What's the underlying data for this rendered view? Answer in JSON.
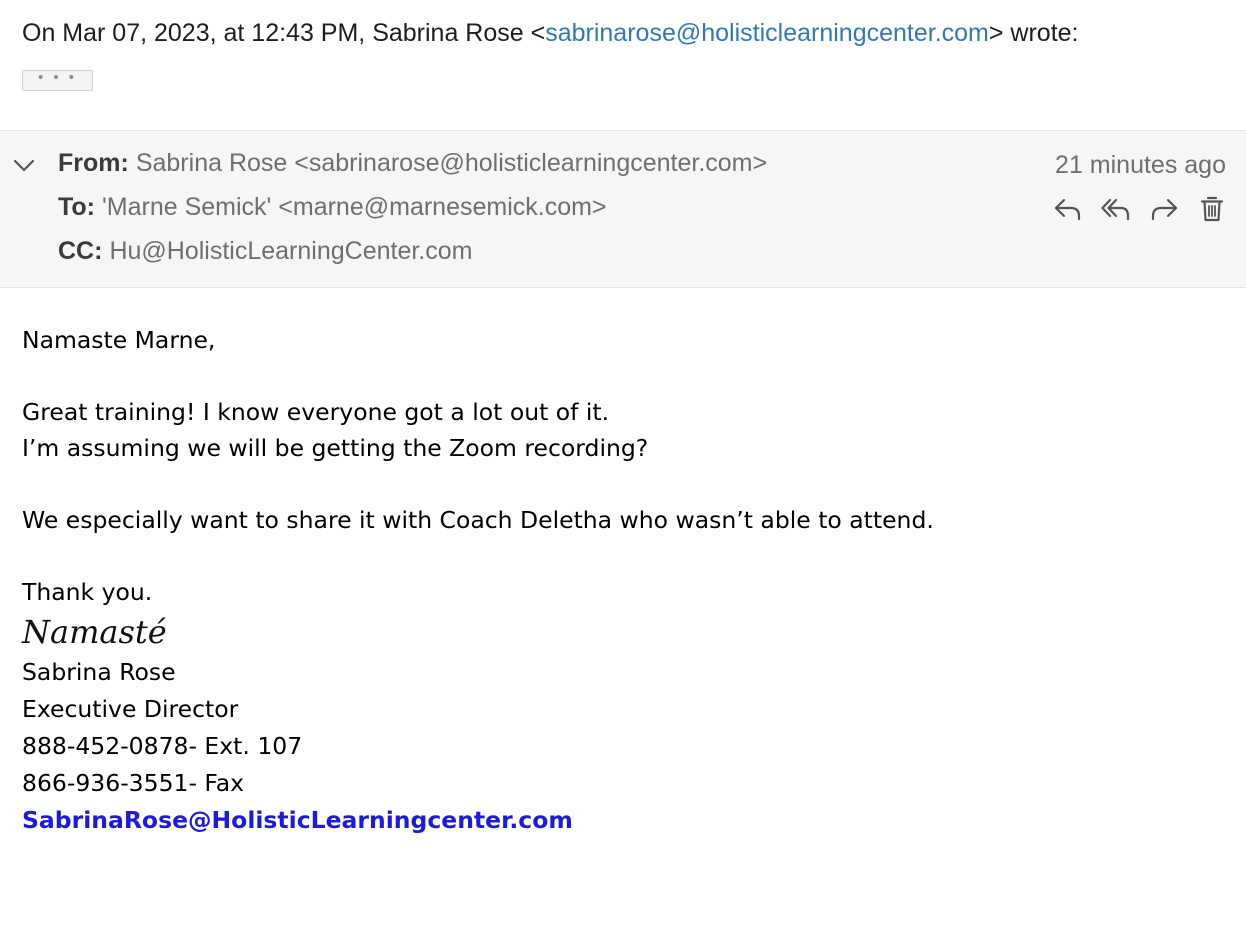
{
  "quoted": {
    "prefix": "On Mar 07, 2023, at 12:43 PM, Sabrina Rose <",
    "email": "sabrinarose@holisticlearningcenter.com",
    "suffix": "> wrote:",
    "ellipsis": "• • •"
  },
  "header": {
    "from_label": "From:",
    "from_value": "Sabrina Rose <sabrinarose@holisticlearningcenter.com>",
    "to_label": "To:",
    "to_value": "'Marne Semick' <marne@marnesemick.com>",
    "cc_label": "CC:",
    "cc_value": "Hu@HolisticLearningCenter.com",
    "timestamp": "21 minutes ago",
    "actions": [
      "reply-icon",
      "reply-all-icon",
      "forward-icon",
      "trash-icon"
    ]
  },
  "body": {
    "greeting": "Namaste Marne,",
    "line1": "Great training! I know everyone got a lot out of it.",
    "line2": "I’m assuming we will be getting the Zoom recording?",
    "line3": "We especially want to share it with Coach Deletha who wasn’t able to attend.",
    "thanks": "Thank you."
  },
  "signature": {
    "script": "Namasté",
    "name": "Sabrina Rose",
    "title": "Executive Director",
    "phone": "888-452-0878- Ext. 107",
    "fax": "866-936-3551- Fax",
    "email": "SabrinaRose@HolisticLearningcenter.com"
  },
  "colors": {
    "link": "#3477b8",
    "signature_link": "#1a1ae0",
    "header_bg": "#f6f6f6"
  }
}
